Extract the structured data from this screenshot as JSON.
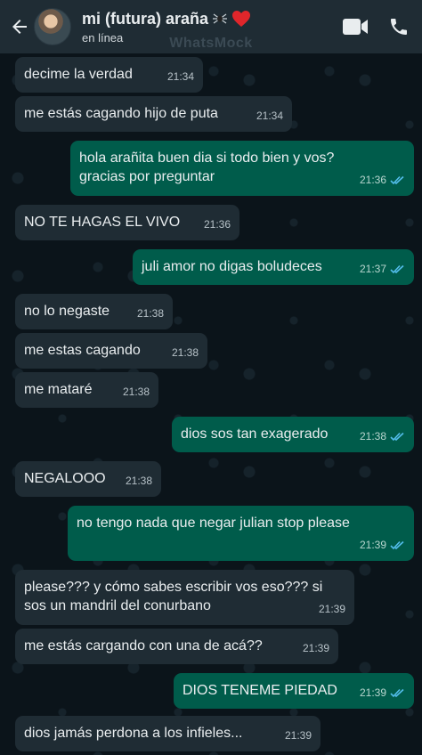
{
  "header": {
    "contact_name": "mi (futura) araña",
    "status": "en línea",
    "watermark": "WhatsMock"
  },
  "icons": {
    "back": "arrow-left-icon",
    "video": "video-call-icon",
    "call": "phone-icon",
    "spider": "spider-emoji-icon",
    "heart": "heart-emoji-icon",
    "read": "double-check-icon"
  },
  "colors": {
    "header_bg": "#1f2c34",
    "incoming_bubble": "#1f2c34",
    "outgoing_bubble": "#005c4b",
    "read_ticks": "#53bdeb",
    "heart": "#e0262b"
  },
  "messages": [
    {
      "dir": "in",
      "text": "decime la verdad",
      "time": "21:34"
    },
    {
      "dir": "in",
      "text": "me estás cagando hijo de puta",
      "time": "21:34"
    },
    {
      "dir": "out",
      "text": "hola arañita buen dia si todo bien y vos?\ngracias por preguntar",
      "time": "21:36"
    },
    {
      "dir": "in",
      "text": "NO TE HAGAS EL VIVO",
      "time": "21:36"
    },
    {
      "dir": "out",
      "text": "juli amor no digas boludeces",
      "time": "21:37"
    },
    {
      "dir": "in",
      "text": "no lo negaste",
      "time": "21:38"
    },
    {
      "dir": "in",
      "text": "me estas cagando",
      "time": "21:38"
    },
    {
      "dir": "in",
      "text": "me mataré",
      "time": "21:38"
    },
    {
      "dir": "out",
      "text": "dios sos tan exagerado",
      "time": "21:38"
    },
    {
      "dir": "in",
      "text": "NEGALOOO",
      "time": "21:38"
    },
    {
      "dir": "out",
      "text": "no tengo nada que negar julian stop please",
      "time": "21:39"
    },
    {
      "dir": "in",
      "text": "please??? y cómo sabes escribir vos eso??? si\nsos un mandril del conurbano",
      "time": "21:39"
    },
    {
      "dir": "in",
      "text": "me estás cargando con una de acá??",
      "time": "21:39"
    },
    {
      "dir": "out",
      "text": "DIOS TENEME PIEDAD",
      "time": "21:39"
    },
    {
      "dir": "in",
      "text": "dios jamás perdona a los infieles...",
      "time": "21:39"
    }
  ]
}
